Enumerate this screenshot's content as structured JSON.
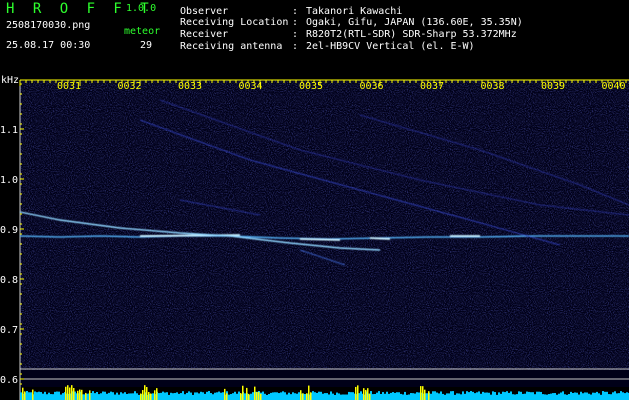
{
  "app": {
    "name": "H R O F F T",
    "version": "1.0.0"
  },
  "capture": {
    "filename": "2508170030.png",
    "datetime": "25.08.17 00:30",
    "meteor_label": "meteor",
    "meteor_count": "29"
  },
  "info": [
    {
      "key": "Observer",
      "sep": ":",
      "value": "Takanori Kawachi"
    },
    {
      "key": "Receiving Location",
      "sep": ":",
      "value": "Ogaki, Gifu, JAPAN (136.60E, 35.35N)"
    },
    {
      "key": "Receiver",
      "sep": ":",
      "value": "R820T2(RTL-SDR) SDR-Sharp 53.372MHz"
    },
    {
      "key": "Receiving antenna",
      "sep": ":",
      "value": "2el-HB9CV Vertical (el. E-W)"
    }
  ],
  "axis": {
    "unit": "kHz",
    "freq_ticks": [
      "1.1",
      "1.0",
      "0.9",
      "0.8",
      "0.7",
      "0.6"
    ],
    "time_ticks": [
      "0031",
      "0032",
      "0033",
      "0034",
      "0035",
      "0036",
      "0037",
      "0038",
      "0039",
      "0040"
    ]
  },
  "colors": {
    "label_green": "#2dff2d",
    "text_white": "#ffffff",
    "tick_yellow": "#ffff00",
    "background": "#000000",
    "noise": "#1a1e8c",
    "echo": "#c8f0ff",
    "level_cyan": "#00c8ff",
    "level_yellow": "#ffff00"
  }
}
